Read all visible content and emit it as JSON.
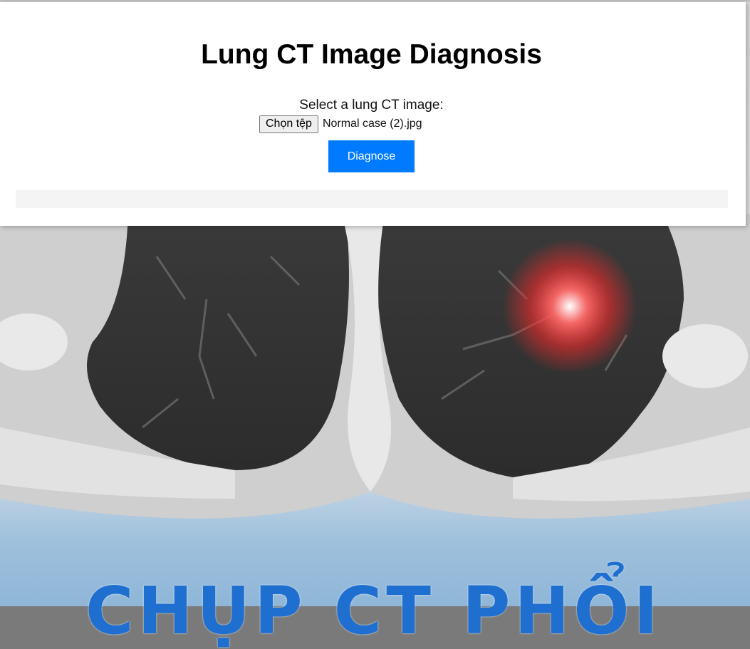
{
  "page": {
    "title": "Lung CT Image Diagnosis",
    "select_label": "Select a lung CT image:",
    "file_button_label": "Chọn tệp",
    "file_name": "Normal case (2).jpg",
    "diagnose_button_label": "Diagnose",
    "result_text": ""
  },
  "background": {
    "banner_text": "CHỤP CT PHỔI",
    "accent_color": "#007bff",
    "highlight_color": "#ff3030"
  }
}
